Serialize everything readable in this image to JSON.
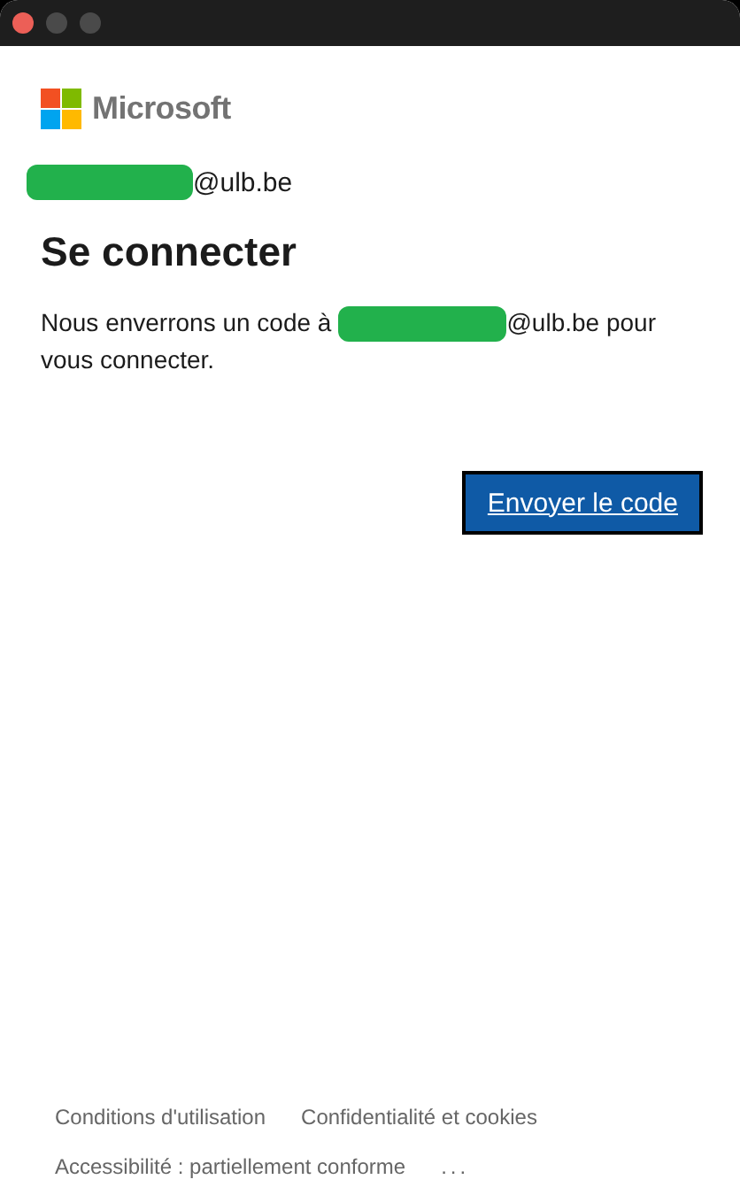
{
  "brand": "Microsoft",
  "account": {
    "redacted": true,
    "domain": "@ulb.be"
  },
  "title": "Se connecter",
  "message": {
    "before": "Nous enverrons un code à",
    "redacted": true,
    "after": "@ulb.be pour",
    "continuation": "vous connecter."
  },
  "button": "Envoyer le code",
  "footer": [
    {
      "label": "Conditions d'utilisation",
      "kind": "link"
    },
    {
      "label": "Confidentialité et cookies",
      "kind": "link"
    },
    {
      "label": "Accessibilité : partiellement conforme",
      "kind": "link"
    },
    {
      "label": "...",
      "kind": "more"
    }
  ]
}
